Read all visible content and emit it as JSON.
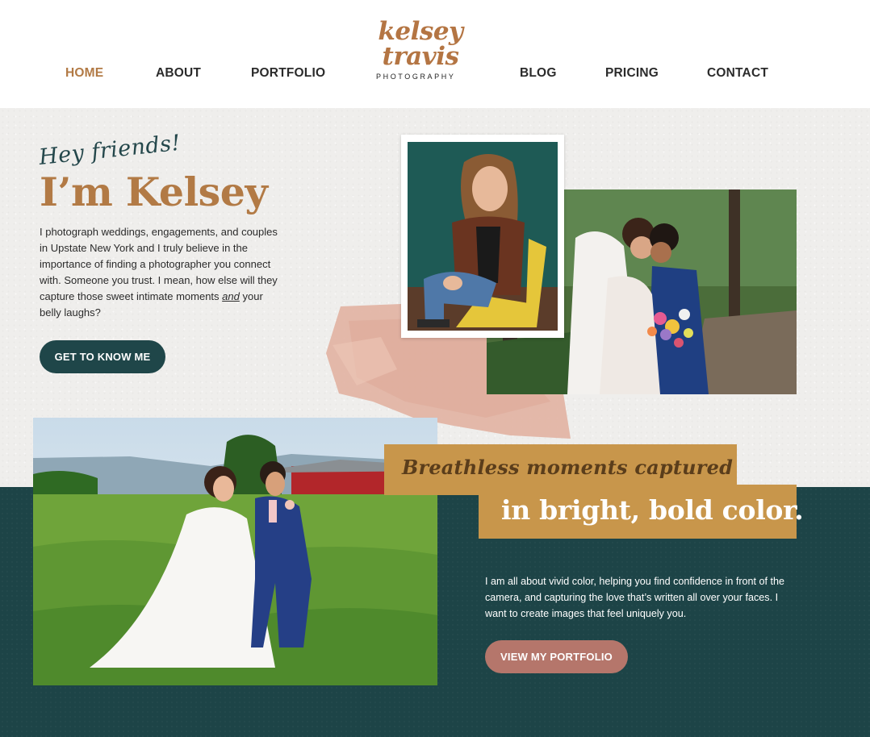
{
  "nav": {
    "left": [
      "HOME",
      "ABOUT",
      "PORTFOLIO"
    ],
    "right": [
      "BLOG",
      "PRICING",
      "CONTACT"
    ]
  },
  "logo": {
    "line1": "kelsey",
    "line2": "travis",
    "sub": "PHOTOGRAPHY"
  },
  "hero": {
    "greeting": "Hey friends!",
    "title": "I’m Kelsey",
    "text_part1": "I photograph weddings, engagements, and couples in Upstate New York and I truly believe in the importance of finding a photographer you connect with. Someone you trust. I mean, how else will they capture those sweet intimate moments ",
    "text_em": "and",
    "text_part2": " your belly laughs?",
    "button": "GET TO KNOW ME"
  },
  "feature": {
    "tagline1": "Breathless moments captured",
    "tagline2": "in bright, bold color.",
    "text": "I am all about vivid color, helping you find confidence in front of the camera, and capturing the love that’s written all over your faces. I want to create images that feel uniquely you.",
    "button": "VIEW MY PORTFOLIO"
  },
  "colors": {
    "accent_brown": "#b27a45",
    "dark_teal": "#1d4447",
    "gold": "#c8964b",
    "rose": "#b5766b",
    "brush_pink": "#e2b3a3"
  }
}
